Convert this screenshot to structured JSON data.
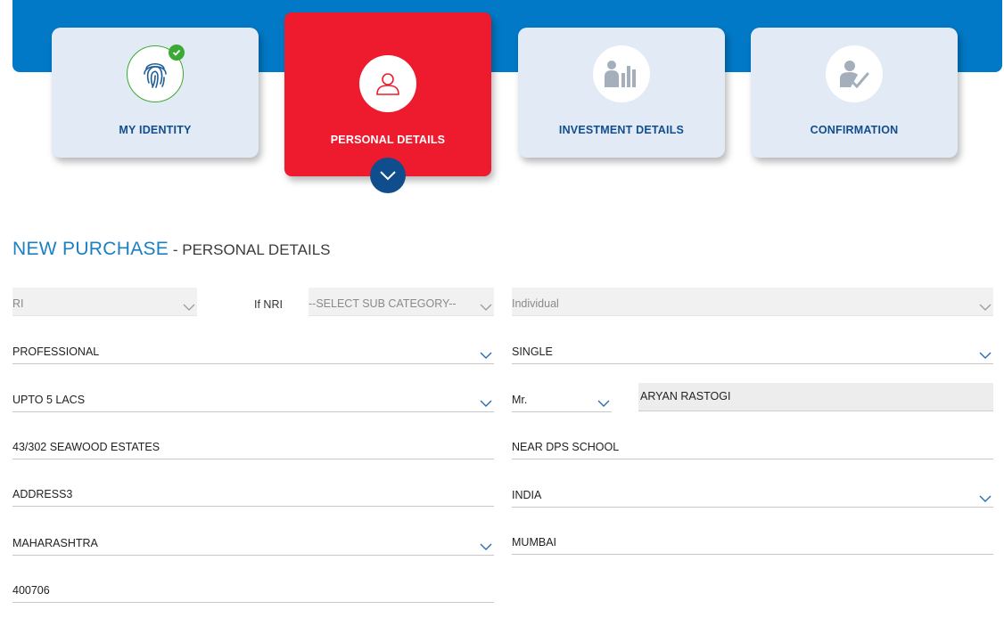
{
  "steps": [
    {
      "label": "MY IDENTITY",
      "icon": "fingerprint-icon",
      "state": "completed"
    },
    {
      "label": "PERSONAL DETAILS",
      "icon": "user-icon",
      "state": "active"
    },
    {
      "label": "INVESTMENT DETAILS",
      "icon": "investment-chart-icon",
      "state": "pending"
    },
    {
      "label": "CONFIRMATION",
      "icon": "user-check-icon",
      "state": "pending"
    }
  ],
  "heading": {
    "main": "NEW PURCHASE",
    "sub": " - PERSONAL DETAILS"
  },
  "form": {
    "residency": "RI",
    "nri_label": "If NRI",
    "nri_sub_category": "--SELECT SUB CATEGORY--",
    "holder_type": "Individual",
    "occupation": "PROFESSIONAL",
    "marital_status": "SINGLE",
    "income": "UPTO 5 LACS",
    "salutation": "Mr.",
    "full_name": "ARYAN RASTOGI",
    "address1": "43/302 SEAWOOD ESTATES",
    "address2": "NEAR DPS SCHOOL",
    "address3": "ADDRESS3",
    "country": "INDIA",
    "state": "MAHARASHTRA",
    "city": "MUMBAI",
    "pincode": "400706"
  },
  "colors": {
    "brand_blue": "#0179c6",
    "active_red": "#ee1b2e",
    "step_card_bg": "#e2eaf5",
    "success_green": "#3aaa35",
    "label_navy": "#124e8d"
  }
}
